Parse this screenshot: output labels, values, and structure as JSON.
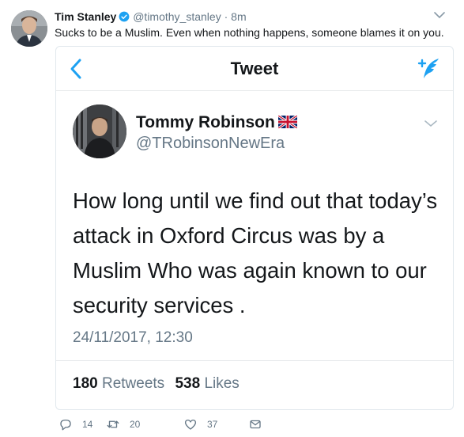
{
  "outer_tweet": {
    "name": "Tim Stanley",
    "handle": "@timothy_stanley",
    "separator": "·",
    "time": "8m",
    "text": "Sucks to be a Muslim. Even when nothing happens, someone blames it on you."
  },
  "embed": {
    "nav_title": "Tweet",
    "back_icon": "chevron-left-icon",
    "compose_icon": "compose-tweet-icon",
    "accent_color": "#1da1f2",
    "inner_tweet": {
      "name": "Tommy Robinson",
      "flag_icon": "uk-flag-icon",
      "handle": "@TRobinsonNewEra",
      "text_lines": [
        "How long until we find out that today’s",
        "attack in Oxford Circus was by a",
        "Muslim Who was again known to our",
        "security services ."
      ],
      "timestamp": "24/11/2017, 12:30",
      "retweets_count": "180",
      "retweets_label": "Retweets",
      "likes_count": "538",
      "likes_label": "Likes"
    }
  },
  "actions": {
    "reply_count": "14",
    "retweet_count": "20",
    "like_count": "37"
  }
}
